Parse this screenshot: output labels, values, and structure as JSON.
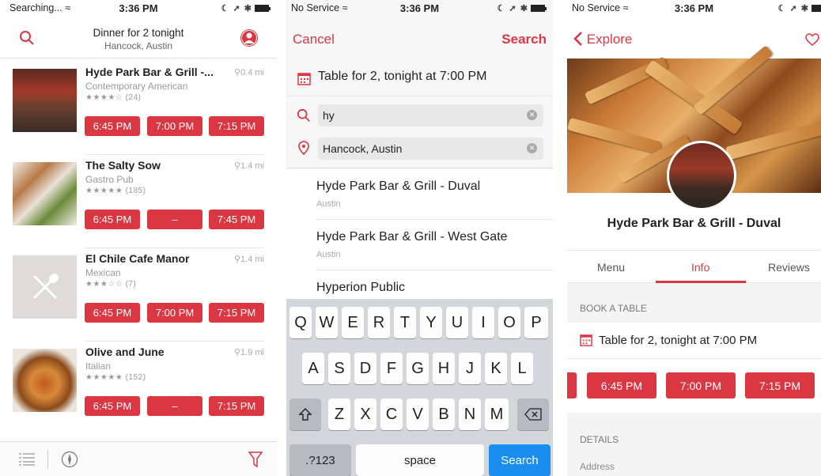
{
  "s1": {
    "status": {
      "carrier": "Searching...",
      "time": "3:36 PM"
    },
    "title": "Dinner for 2 tonight",
    "subtitle": "Hancock, Austin",
    "restaurants": [
      {
        "name": "Hyde Park Bar & Grill -...",
        "dist": "0.4 mi",
        "cuisine": "Contemporary American",
        "stars": "★★★★☆ (24)",
        "times": [
          "6:45 PM",
          "7:00 PM",
          "7:15 PM"
        ]
      },
      {
        "name": "The Salty Sow",
        "dist": "1.4 mi",
        "cuisine": "Gastro Pub",
        "stars": "★★★★★ (185)",
        "times": [
          "6:45 PM",
          "–",
          "7:45 PM"
        ]
      },
      {
        "name": "El Chile Cafe Manor",
        "dist": "1.4 mi",
        "cuisine": "Mexican",
        "stars": "★★★☆☆ (7)",
        "times": [
          "6:45 PM",
          "7:00 PM",
          "7:15 PM"
        ]
      },
      {
        "name": "Olive and June",
        "dist": "1.9 mi",
        "cuisine": "Italian",
        "stars": "★★★★★ (152)",
        "times": [
          "6:45 PM",
          "–",
          "7:15 PM"
        ]
      }
    ]
  },
  "s2": {
    "status": {
      "carrier": "No Service",
      "time": "3:36 PM"
    },
    "cancel": "Cancel",
    "search": "Search",
    "table": "Table for 2, tonight at 7:00 PM",
    "query": "hy",
    "location": "Hancock, Austin",
    "results": [
      {
        "name": "Hyde Park Bar & Grill - Duval",
        "area": "Austin"
      },
      {
        "name": "Hyde Park Bar & Grill - West Gate",
        "area": "Austin"
      },
      {
        "name": "Hyperion Public",
        "area": ""
      }
    ],
    "keyboard": {
      "row1": [
        "Q",
        "W",
        "E",
        "R",
        "T",
        "Y",
        "U",
        "I",
        "O",
        "P"
      ],
      "row2": [
        "A",
        "S",
        "D",
        "F",
        "G",
        "H",
        "J",
        "K",
        "L"
      ],
      "row3": [
        "Z",
        "X",
        "C",
        "V",
        "B",
        "N",
        "M"
      ],
      "numbers": ".?123",
      "space": "space",
      "go": "Search"
    }
  },
  "s3": {
    "status": {
      "carrier": "No Service",
      "time": "3:36 PM"
    },
    "back": "Explore",
    "name": "Hyde Park Bar & Grill - Duval",
    "tabs": [
      "Menu",
      "Info",
      "Reviews"
    ],
    "book_header": "BOOK A TABLE",
    "table": "Table for 2, tonight at 7:00 PM",
    "times": [
      "6:45 PM",
      "7:00 PM",
      "7:15 PM"
    ],
    "details_header": "DETAILS",
    "address_label": "Address"
  },
  "colors": {
    "accent": "#da3743"
  }
}
